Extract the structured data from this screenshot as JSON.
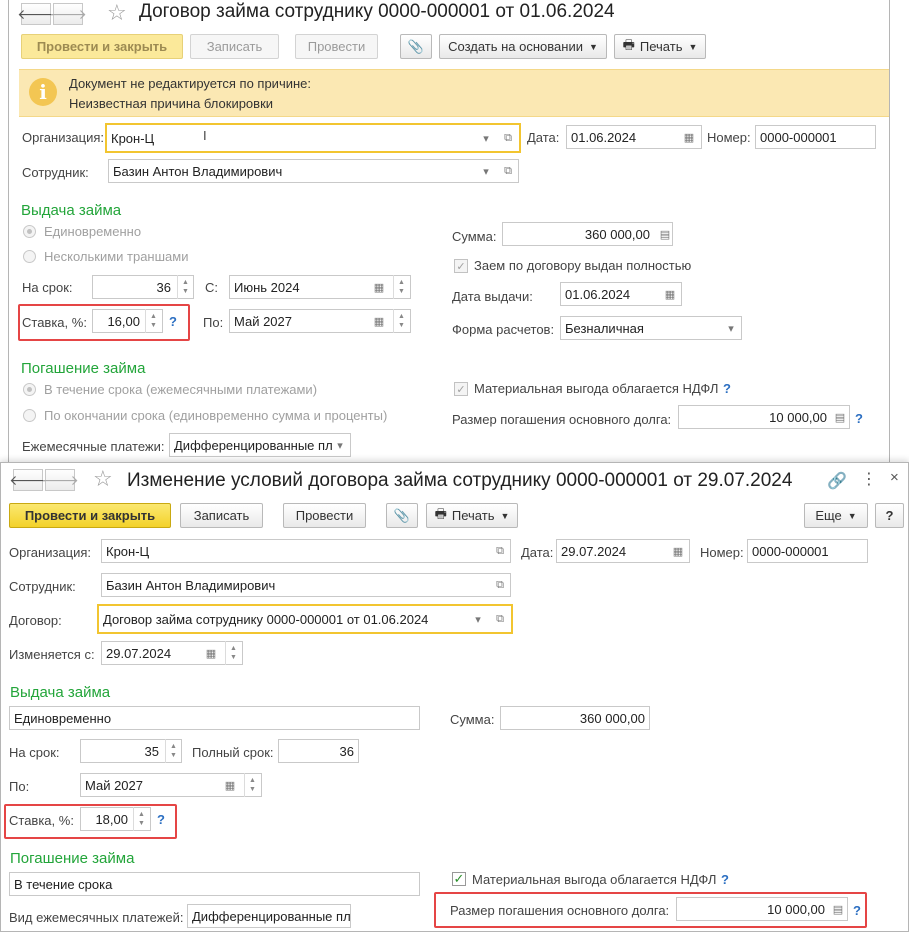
{
  "doc1": {
    "title": "Договор займа сотруднику 0000-000001 от 01.06.2024",
    "toolbar": {
      "post_close": "Провести и закрыть",
      "save": "Записать",
      "post": "Провести",
      "create_based": "Создать на основании",
      "print": "Печать"
    },
    "warning": {
      "line1": "Документ не редактируется по причине:",
      "line2": "Неизвестная причина блокировки"
    },
    "org_label": "Организация:",
    "org_value": "Крон-Ц",
    "date_label": "Дата:",
    "date_value": "01.06.2024",
    "number_label": "Номер:",
    "number_value": "0000-000001",
    "employee_label": "Сотрудник:",
    "employee_value": "Базин Антон Владимирович",
    "issue_section": "Выдача займа",
    "issue_once": "Единовременно",
    "issue_tranches": "Несколькими траншами",
    "term_label": "На срок:",
    "term_value": "36",
    "from_label": "С:",
    "from_value": "Июнь 2024",
    "rate_label": "Ставка, %:",
    "rate_value": "16,00",
    "to_label": "По:",
    "to_value": "Май 2027",
    "sum_label": "Сумма:",
    "sum_value": "360 000,00",
    "issued_fully_label": "Заем по договору выдан полностью",
    "issue_date_label": "Дата выдачи:",
    "issue_date_value": "01.06.2024",
    "payment_form_label": "Форма расчетов:",
    "payment_form_value": "Безналичная",
    "repay_section": "Погашение займа",
    "repay_during": "В течение срока (ежемесячными платежами)",
    "repay_end": "По окончании срока (единовременно сумма и проценты)",
    "monthly_label": "Ежемесячные платежи:",
    "monthly_value": "Дифференцированные пл",
    "benefit_label": "Материальная выгода облагается НДФЛ",
    "principal_label": "Размер погашения основного долга:",
    "principal_value": "10 000,00",
    "help": "?"
  },
  "doc2": {
    "title": "Изменение условий договора займа сотруднику 0000-000001 от 29.07.2024",
    "toolbar": {
      "post_close": "Провести и закрыть",
      "save": "Записать",
      "post": "Провести",
      "print": "Печать",
      "more": "Еще",
      "help": "?"
    },
    "org_label": "Организация:",
    "org_value": "Крон-Ц",
    "date_label": "Дата:",
    "date_value": "29.07.2024",
    "number_label": "Номер:",
    "number_value": "0000-000001",
    "employee_label": "Сотрудник:",
    "employee_value": "Базин Антон Владимирович",
    "contract_label": "Договор:",
    "contract_value": "Договор займа сотруднику 0000-000001 от 01.06.2024",
    "changed_from_label": "Изменяется с:",
    "changed_from_value": "29.07.2024",
    "issue_section": "Выдача займа",
    "issue_value": "Единовременно",
    "sum_label": "Сумма:",
    "sum_value": "360 000,00",
    "term_label": "На срок:",
    "term_value": "35",
    "full_term_label": "Полный срок:",
    "full_term_value": "36",
    "to_label": "По:",
    "to_value": "Май 2027",
    "rate_label": "Ставка, %:",
    "rate_value": "18,00",
    "repay_section": "Погашение займа",
    "repay_value": "В течение срока",
    "benefit_label": "Материальная выгода облагается НДФЛ",
    "monthly_kind_label": "Вид ежемесячных платежей:",
    "monthly_kind_value": "Дифференцированные пл",
    "principal_label": "Размер погашения основного долга:",
    "principal_value": "10 000,00",
    "help": "?"
  }
}
